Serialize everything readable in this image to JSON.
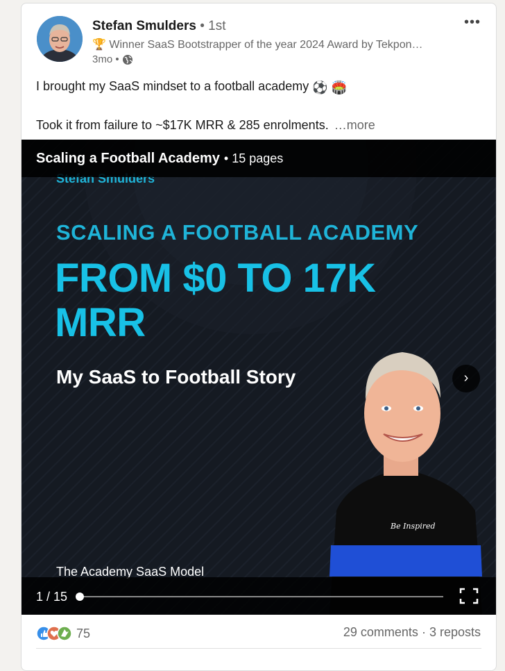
{
  "post": {
    "author": {
      "name": "Stefan Smulders",
      "degree": "• 1st",
      "headline": "🏆 Winner SaaS Bootstrapper of the year 2024 Award by Tekpon…",
      "time": "3mo •",
      "visibility_icon": "globe-icon",
      "avatar_icon": "avatar-photo"
    },
    "menu_icon": "ellipsis-icon",
    "menu_label": "•••",
    "text_line1": "I brought my SaaS mindset to a football academy",
    "text_line1_emojis": "⚽ 🏟️",
    "text_line2": "Took it from failure to ~$17K MRR & 285 enrolments.",
    "see_more": "…more"
  },
  "document": {
    "title": "Scaling a Football Academy",
    "pages_label": "• 15 pages",
    "slide": {
      "author": "Stefan Smulders",
      "kicker": "SCALING A FOOTBALL ACADEMY",
      "headline": "FROM $0 TO 17K MRR",
      "subtitle": "My SaaS to Football Story",
      "footer": "The Academy SaaS Model",
      "shirt_text": "Be Inspired"
    },
    "next_label": "›",
    "page_counter": "1 / 15",
    "progress": 0,
    "fullscreen_icon": "fullscreen-icon"
  },
  "social": {
    "reaction_icons": [
      "like-icon",
      "love-icon",
      "celebrate-icon"
    ],
    "reaction_count": "75",
    "comments": "29 comments",
    "separator": "·",
    "reposts": "3 reposts"
  },
  "colors": {
    "accent_cyan": "#18c1e6",
    "slide_bg": "#151a22",
    "muted_text": "#666666"
  }
}
